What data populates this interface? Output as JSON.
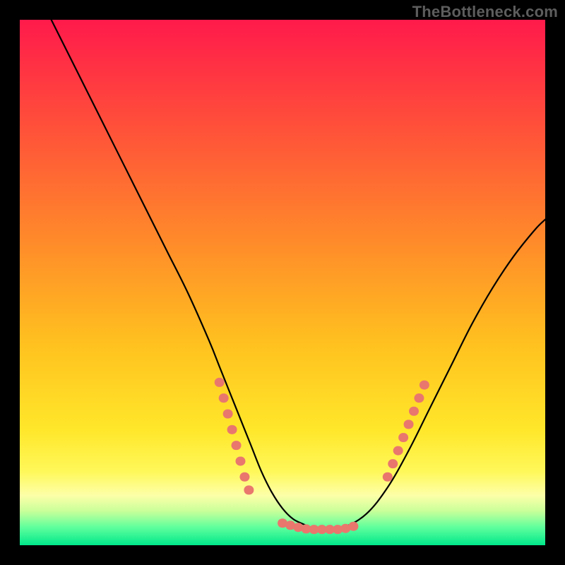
{
  "watermark": "TheBottleneck.com",
  "chart_data": {
    "type": "line",
    "title": "",
    "xlabel": "",
    "ylabel": "",
    "xlim": [
      0,
      100
    ],
    "ylim": [
      0,
      100
    ],
    "grid": false,
    "legend": false,
    "background_gradient_stops": [
      {
        "offset": 0.0,
        "color": "#ff1a4b"
      },
      {
        "offset": 0.2,
        "color": "#ff4f3a"
      },
      {
        "offset": 0.42,
        "color": "#ff8a2a"
      },
      {
        "offset": 0.62,
        "color": "#ffc21f"
      },
      {
        "offset": 0.78,
        "color": "#ffe72a"
      },
      {
        "offset": 0.86,
        "color": "#fff85a"
      },
      {
        "offset": 0.905,
        "color": "#fdffa8"
      },
      {
        "offset": 0.935,
        "color": "#c9ff9a"
      },
      {
        "offset": 0.965,
        "color": "#62ff9d"
      },
      {
        "offset": 1.0,
        "color": "#00e88b"
      }
    ],
    "series": [
      {
        "name": "bottleneck-curve",
        "color": "#000000",
        "x": [
          6,
          8,
          12,
          16,
          20,
          24,
          28,
          32,
          36,
          38,
          40,
          42,
          44,
          46,
          48,
          50,
          52,
          54,
          56,
          58,
          60,
          62,
          66,
          70,
          74,
          78,
          82,
          86,
          90,
          94,
          98,
          100
        ],
        "y": [
          100,
          96,
          88,
          80,
          72,
          64,
          56,
          48,
          39,
          34,
          29,
          24,
          19,
          14,
          10,
          7,
          5,
          4,
          3.2,
          3,
          3,
          3.5,
          6,
          11,
          18,
          26,
          34,
          42,
          49,
          55,
          60,
          62
        ]
      }
    ],
    "marker_groups": [
      {
        "name": "left-cluster",
        "color": "#e9776e",
        "points": [
          {
            "x": 38.0,
            "y": 31.0
          },
          {
            "x": 38.8,
            "y": 28.0
          },
          {
            "x": 39.6,
            "y": 25.0
          },
          {
            "x": 40.4,
            "y": 22.0
          },
          {
            "x": 41.2,
            "y": 19.0
          },
          {
            "x": 42.0,
            "y": 16.0
          },
          {
            "x": 42.8,
            "y": 13.0
          },
          {
            "x": 43.6,
            "y": 10.5
          }
        ]
      },
      {
        "name": "valley-cluster",
        "color": "#e9776e",
        "points": [
          {
            "x": 50.0,
            "y": 4.2
          },
          {
            "x": 51.5,
            "y": 3.8
          },
          {
            "x": 53.0,
            "y": 3.4
          },
          {
            "x": 54.5,
            "y": 3.1
          },
          {
            "x": 56.0,
            "y": 3.0
          },
          {
            "x": 57.5,
            "y": 3.0
          },
          {
            "x": 59.0,
            "y": 3.0
          },
          {
            "x": 60.5,
            "y": 3.0
          },
          {
            "x": 62.0,
            "y": 3.2
          },
          {
            "x": 63.5,
            "y": 3.6
          }
        ]
      },
      {
        "name": "right-cluster",
        "color": "#e9776e",
        "points": [
          {
            "x": 70.0,
            "y": 13.0
          },
          {
            "x": 71.0,
            "y": 15.5
          },
          {
            "x": 72.0,
            "y": 18.0
          },
          {
            "x": 73.0,
            "y": 20.5
          },
          {
            "x": 74.0,
            "y": 23.0
          },
          {
            "x": 75.0,
            "y": 25.5
          },
          {
            "x": 76.0,
            "y": 28.0
          },
          {
            "x": 77.0,
            "y": 30.5
          }
        ]
      }
    ]
  }
}
